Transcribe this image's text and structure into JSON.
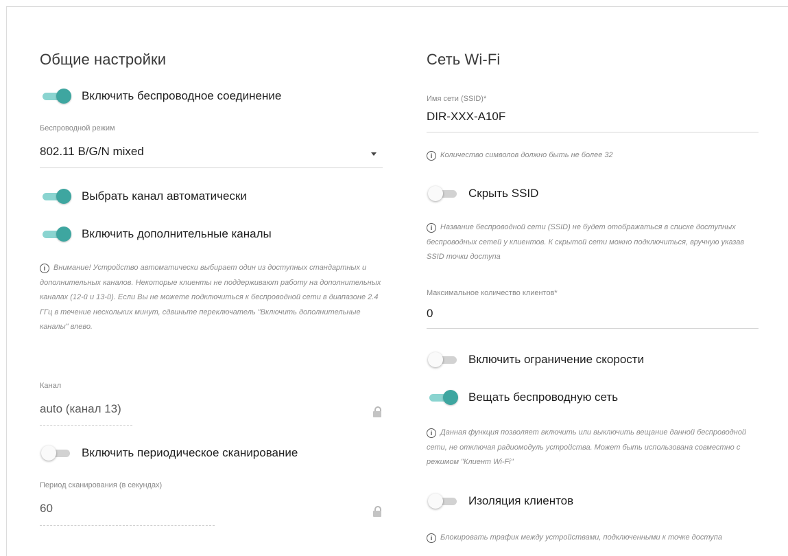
{
  "general": {
    "title": "Общие настройки",
    "wireless_enable_label": "Включить беспроводное соединение",
    "mode_label": "Беспроводной режим",
    "mode_value": "802.11 B/G/N mixed",
    "auto_channel_label": "Выбрать канал автоматически",
    "extra_channels_label": "Включить дополнительные каналы",
    "extra_channels_note": "Внимание! Устройство автоматически выбирает один из доступных стандартных и дополнительных каналов. Некоторые клиенты не поддерживают работу на дополнительных каналах (12-й и 13-й). Если Вы не можете подключиться к беспроводной сети в диапазоне 2.4 ГГц в течение нескольких минут, сдвиньте переключатель \"Включить дополнительные каналы\" влево.",
    "channel_label": "Канал",
    "channel_value": "auto (канал 13)",
    "periodic_scan_label": "Включить периодическое сканирование",
    "scan_period_label": "Период сканирования (в секундах)",
    "scan_period_value": "60"
  },
  "wifi": {
    "title": "Сеть Wi-Fi",
    "ssid_label": "Имя сети (SSID)*",
    "ssid_value": "DIR-XXX-A10F",
    "ssid_note": "Количество символов должно быть не более 32",
    "hide_ssid_label": "Скрыть SSID",
    "hide_ssid_note": "Название беспроводной сети (SSID) не будет отображаться в списке доступных беспроводных сетей у клиентов. К скрытой сети можно подключиться, вручную указав SSID точки доступа",
    "max_clients_label": "Максимальное количество клиентов*",
    "max_clients_value": "0",
    "speed_limit_label": "Включить ограничение скорости",
    "broadcast_label": "Вещать беспроводную сеть",
    "broadcast_note": "Данная функция позволяет включить или выключить вещание данной беспроводной сети, не отключая радиомодуль устройства. Может быть использована совместно с режимом \"Клиент Wi-Fi\"",
    "isolation_label": "Изоляция клиентов",
    "isolation_note": "Блокировать трафик между устройствами, подключенными к точке доступа"
  },
  "toggles": {
    "wireless_enable": true,
    "auto_channel": true,
    "extra_channels": true,
    "periodic_scan": false,
    "hide_ssid": false,
    "speed_limit": false,
    "broadcast": true,
    "isolation": false
  },
  "colors": {
    "toggle_on_knob": "#3ea6a0",
    "toggle_on_track": "#8ad4d0",
    "toggle_off_track": "#d2d2d2"
  },
  "icons": {
    "info": "info-icon",
    "lock": "lock-icon",
    "dropdown": "chevron-down-icon"
  }
}
